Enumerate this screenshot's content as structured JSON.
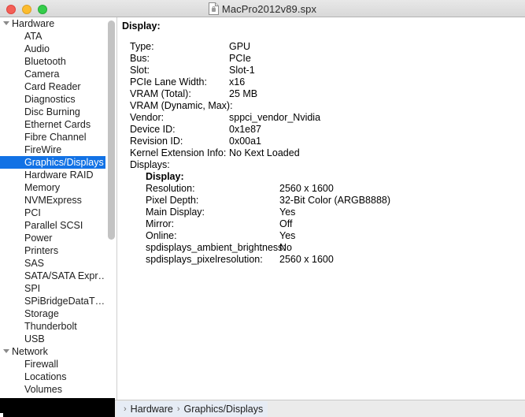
{
  "window": {
    "title": "MacPro2012v89.spx",
    "doc_icon": "document-icon",
    "traffic_lights": {
      "close": "close-button",
      "minimize": "minimize-button",
      "zoom": "zoom-button"
    }
  },
  "sidebar": {
    "items": [
      {
        "label": "Hardware",
        "level": "group",
        "selected": false
      },
      {
        "label": "ATA",
        "level": "child",
        "selected": false
      },
      {
        "label": "Audio",
        "level": "child",
        "selected": false
      },
      {
        "label": "Bluetooth",
        "level": "child",
        "selected": false
      },
      {
        "label": "Camera",
        "level": "child",
        "selected": false
      },
      {
        "label": "Card Reader",
        "level": "child",
        "selected": false
      },
      {
        "label": "Diagnostics",
        "level": "child",
        "selected": false
      },
      {
        "label": "Disc Burning",
        "level": "child",
        "selected": false
      },
      {
        "label": "Ethernet Cards",
        "level": "child",
        "selected": false
      },
      {
        "label": "Fibre Channel",
        "level": "child",
        "selected": false
      },
      {
        "label": "FireWire",
        "level": "child",
        "selected": false
      },
      {
        "label": "Graphics/Displays",
        "level": "child",
        "selected": true
      },
      {
        "label": "Hardware RAID",
        "level": "child",
        "selected": false
      },
      {
        "label": "Memory",
        "level": "child",
        "selected": false
      },
      {
        "label": "NVMExpress",
        "level": "child",
        "selected": false
      },
      {
        "label": "PCI",
        "level": "child",
        "selected": false
      },
      {
        "label": "Parallel SCSI",
        "level": "child",
        "selected": false
      },
      {
        "label": "Power",
        "level": "child",
        "selected": false
      },
      {
        "label": "Printers",
        "level": "child",
        "selected": false
      },
      {
        "label": "SAS",
        "level": "child",
        "selected": false
      },
      {
        "label": "SATA/SATA Expr…",
        "level": "child",
        "selected": false
      },
      {
        "label": "SPI",
        "level": "child",
        "selected": false
      },
      {
        "label": "SPiBridgeDataT…",
        "level": "child",
        "selected": false
      },
      {
        "label": "Storage",
        "level": "child",
        "selected": false
      },
      {
        "label": "Thunderbolt",
        "level": "child",
        "selected": false
      },
      {
        "label": "USB",
        "level": "child",
        "selected": false
      },
      {
        "label": "Network",
        "level": "group",
        "selected": false
      },
      {
        "label": "Firewall",
        "level": "child",
        "selected": false
      },
      {
        "label": "Locations",
        "level": "child",
        "selected": false
      },
      {
        "label": "Volumes",
        "level": "child",
        "selected": false
      }
    ]
  },
  "detail": {
    "heading": "Display:",
    "gpu_rows": [
      {
        "key": "Type:",
        "value": "GPU"
      },
      {
        "key": "Bus:",
        "value": "PCIe"
      },
      {
        "key": "Slot:",
        "value": "Slot-1"
      },
      {
        "key": "PCIe Lane Width:",
        "value": "x16"
      },
      {
        "key": "VRAM (Total):",
        "value": "25 MB"
      },
      {
        "key": "VRAM (Dynamic, Max):",
        "value": ""
      },
      {
        "key": "Vendor:",
        "value": "sppci_vendor_Nvidia"
      },
      {
        "key": "Device ID:",
        "value": "0x1e87"
      },
      {
        "key": "Revision ID:",
        "value": "0x00a1"
      },
      {
        "key": "Kernel Extension Info:",
        "value": "No Kext Loaded"
      },
      {
        "key": "Displays:",
        "value": ""
      }
    ],
    "display_subheading": "Display:",
    "display_rows": [
      {
        "key": "Resolution:",
        "value": "2560 x 1600"
      },
      {
        "key": "Pixel Depth:",
        "value": "32-Bit Color (ARGB8888)"
      },
      {
        "key": "Main Display:",
        "value": "Yes"
      },
      {
        "key": "Mirror:",
        "value": "Off"
      },
      {
        "key": "Online:",
        "value": "Yes"
      },
      {
        "key": "spdisplays_ambient_brightness:",
        "value": "No"
      },
      {
        "key": "spdisplays_pixelresolution:",
        "value": "2560 x 1600"
      }
    ]
  },
  "breadcrumb": {
    "separator": "›",
    "items": [
      "Hardware",
      "Graphics/Displays"
    ]
  }
}
